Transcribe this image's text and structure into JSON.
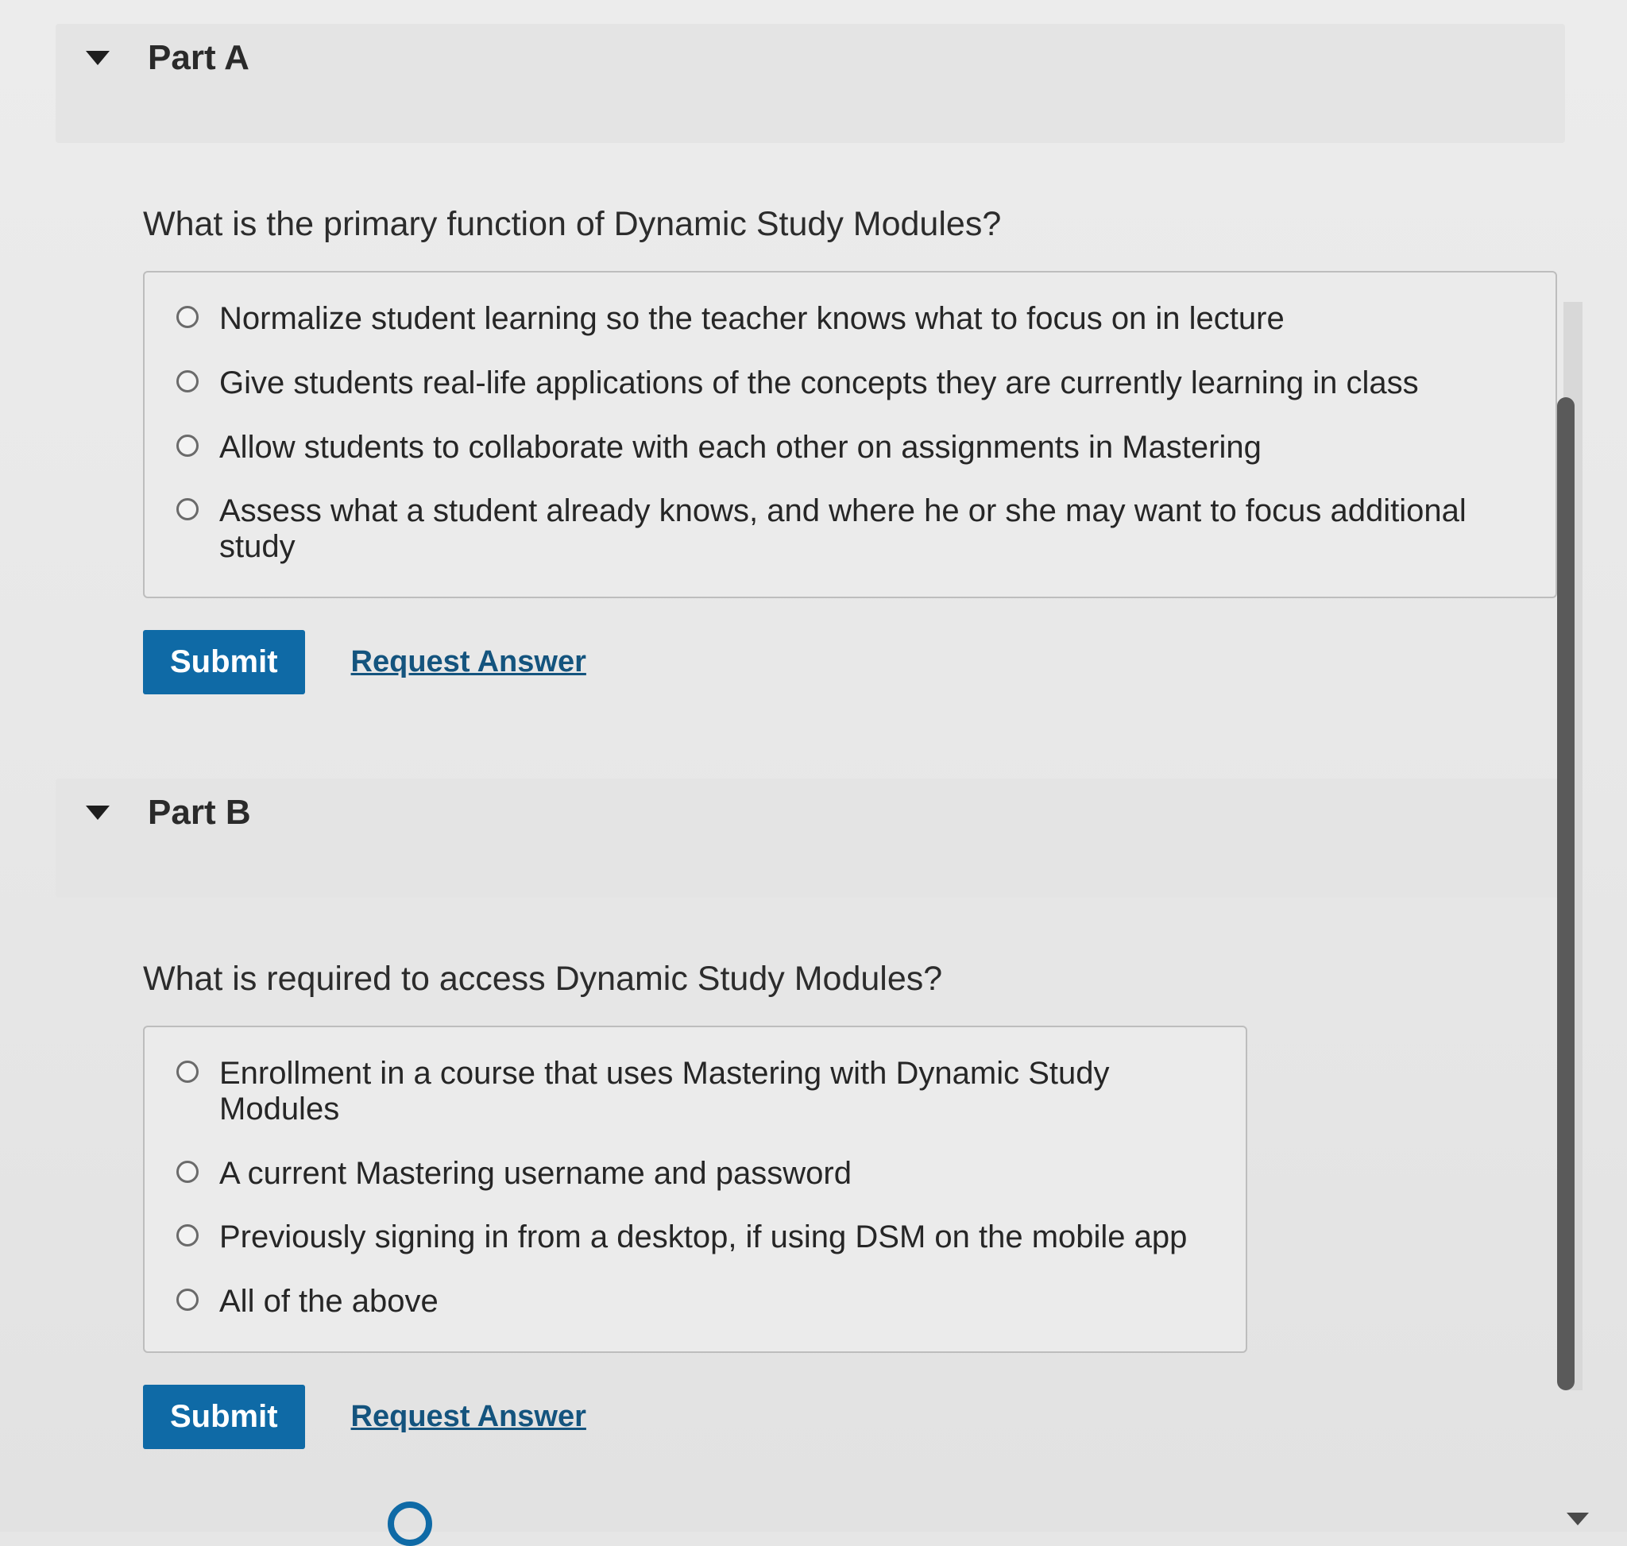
{
  "part_a": {
    "title": "Part A",
    "question": "What is the primary function of Dynamic Study Modules?",
    "choices": [
      "Normalize student learning so the teacher knows what to focus on in lecture",
      "Give students real-life applications of the concepts they are currently learning in class",
      "Allow students to collaborate with each other on assignments in Mastering",
      "Assess what a student already knows, and where he or she may want to focus additional study"
    ],
    "submit_label": "Submit",
    "request_label": "Request Answer"
  },
  "part_b": {
    "title": "Part B",
    "question": "What is required to access Dynamic Study Modules?",
    "choices": [
      "Enrollment in a course that uses Mastering with Dynamic Study Modules",
      "A current Mastering username and password",
      "Previously signing in from a desktop, if using DSM on the mobile app",
      "All of the above"
    ],
    "submit_label": "Submit",
    "request_label": "Request Answer"
  },
  "colors": {
    "accent": "#0f6aa6",
    "link": "#14547e"
  }
}
